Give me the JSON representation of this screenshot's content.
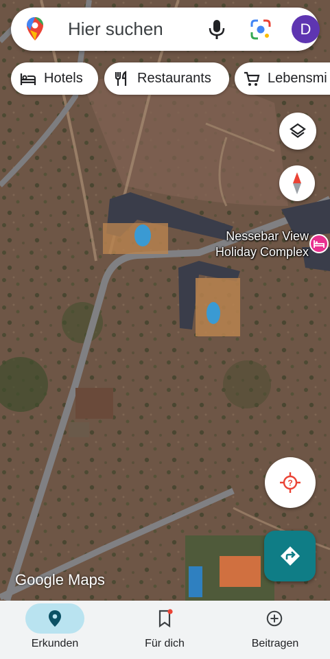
{
  "search": {
    "placeholder": "Hier suchen",
    "avatar_letter": "D"
  },
  "chips": [
    {
      "label": "Hotels",
      "icon": "hotel-icon"
    },
    {
      "label": "Restaurants",
      "icon": "restaurant-icon"
    },
    {
      "label": "Lebensmi",
      "icon": "cart-icon"
    }
  ],
  "map": {
    "place_name": "Nessebar View Holiday Complex",
    "place_category": "hotel",
    "attribution": "Google Maps"
  },
  "bottom_nav": [
    {
      "label": "Erkunden",
      "icon": "location-pin-icon",
      "active": true
    },
    {
      "label": "Für dich",
      "icon": "bookmark-icon",
      "badge": true
    },
    {
      "label": "Beitragen",
      "icon": "add-circle-icon"
    }
  ],
  "colors": {
    "accent_blue": "#1a73e8",
    "directions_teal": "#0f7d86",
    "avatar_purple": "#5e35b1",
    "hotel_pink": "#e8318f",
    "nav_active_pill": "#b9e3f0",
    "locate_red": "#ea4335"
  }
}
